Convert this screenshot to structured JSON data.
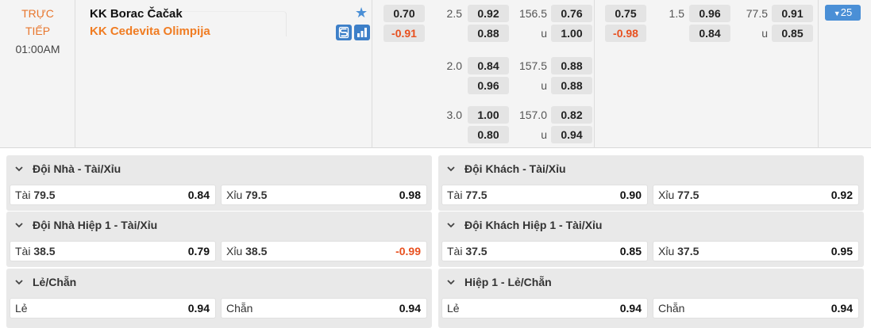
{
  "match": {
    "status_line1": "TRỰC",
    "status_line2": "TIẾP",
    "time": "01:00AM",
    "home_team": "KK Borac Čačak",
    "away_team": "KK Cedevita Olimpija",
    "more_markets": "25",
    "icons": [
      "star-icon",
      "scoreboard-icon",
      "stats-icon"
    ]
  },
  "full_time": {
    "handicap_main": {
      "home": "0.70",
      "away": "-0.91"
    },
    "handicap_lines": [
      {
        "line": "2.5",
        "home": "0.92",
        "away": "0.88"
      },
      {
        "line": "2.0",
        "home": "0.84",
        "away": "0.96"
      },
      {
        "line": "3.0",
        "home": "1.00",
        "away": "0.80"
      }
    ],
    "total_lines": [
      {
        "line": "156.5",
        "u_label": "u",
        "over": "0.76",
        "under": "1.00"
      },
      {
        "line": "157.5",
        "u_label": "u",
        "over": "0.88",
        "under": "0.88"
      },
      {
        "line": "157.0",
        "u_label": "u",
        "over": "0.82",
        "under": "0.94"
      }
    ]
  },
  "first_half": {
    "handicap_main": {
      "home": "0.75",
      "away": "-0.98"
    },
    "handicap_line": {
      "line": "1.5",
      "home": "0.96",
      "away": "0.84"
    },
    "total_line": {
      "line": "77.5",
      "u_label": "u",
      "over": "0.91",
      "under": "0.85"
    }
  },
  "markets": [
    {
      "title": "Đội Nhà - Tài/Xỉu",
      "options": [
        {
          "name": "Tài",
          "line": "79.5",
          "value": "0.84"
        },
        {
          "name": "Xỉu",
          "line": "79.5",
          "value": "0.98"
        }
      ]
    },
    {
      "title": "Đội Khách - Tài/Xỉu",
      "options": [
        {
          "name": "Tài",
          "line": "77.5",
          "value": "0.90"
        },
        {
          "name": "Xỉu",
          "line": "77.5",
          "value": "0.92"
        }
      ]
    },
    {
      "title": "Đội Nhà Hiệp 1 - Tài/Xỉu",
      "options": [
        {
          "name": "Tài",
          "line": "38.5",
          "value": "0.79"
        },
        {
          "name": "Xỉu",
          "line": "38.5",
          "value": "-0.99"
        }
      ]
    },
    {
      "title": "Đội Khách Hiệp 1 - Tài/Xỉu",
      "options": [
        {
          "name": "Tài",
          "line": "37.5",
          "value": "0.85"
        },
        {
          "name": "Xỉu",
          "line": "37.5",
          "value": "0.95"
        }
      ]
    },
    {
      "title": "Lẻ/Chẵn",
      "options": [
        {
          "name": "Lẻ",
          "line": "",
          "value": "0.94"
        },
        {
          "name": "Chẵn",
          "line": "",
          "value": "0.94"
        }
      ]
    },
    {
      "title": "Hiệp 1 - Lẻ/Chẵn",
      "options": [
        {
          "name": "Lẻ",
          "line": "",
          "value": "0.94"
        },
        {
          "name": "Chẵn",
          "line": "",
          "value": "0.94"
        }
      ]
    }
  ],
  "colors": {
    "live": "#e8762c",
    "away_team": "#f07c22",
    "negative": "#e8501f",
    "accent": "#4a8fd6"
  }
}
